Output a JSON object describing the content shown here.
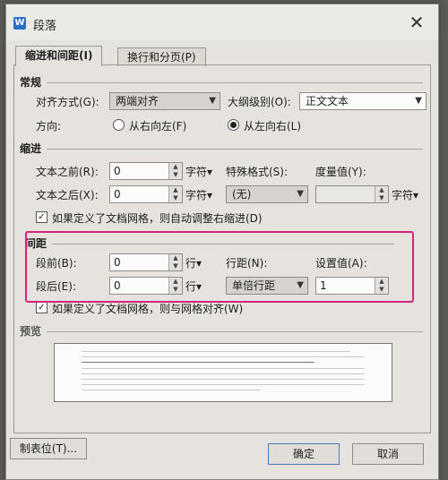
{
  "window": {
    "title": "段落",
    "app_icon": "W"
  },
  "tabs": [
    {
      "label": "缩进和间距(I)",
      "active": true
    },
    {
      "label": "换行和分页(P)",
      "active": false
    }
  ],
  "general": {
    "heading": "常规",
    "alignment_label": "对齐方式(G):",
    "alignment_value": "两端对齐",
    "outline_label": "大纲级别(O):",
    "outline_value": "正文文本",
    "direction_label": "方向:",
    "rtl_label": "从右向左(F)",
    "ltr_label": "从左向右(L)"
  },
  "indent": {
    "heading": "缩进",
    "before_label": "文本之前(R):",
    "before_value": "0",
    "after_label": "文本之后(X):",
    "after_value": "0",
    "unit": "字符▾",
    "special_label": "特殊格式(S):",
    "special_value": "(无)",
    "measure_label": "度量值(Y):",
    "measure_value": "",
    "auto_adjust_label": "如果定义了文档网格，则自动调整右缩进(D)"
  },
  "spacing": {
    "heading": "间距",
    "before_label": "段前(B):",
    "before_value": "0",
    "after_label": "段后(E):",
    "after_value": "0",
    "unit": "行▾",
    "line_label": "行距(N):",
    "line_value": "单倍行距",
    "set_label": "设置值(A):",
    "set_value": "1",
    "snap_label": "如果定义了文档网格，则与网格对齐(W)"
  },
  "preview": {
    "heading": "预览"
  },
  "buttons": {
    "tabs": "制表位(T)...",
    "ok": "确定",
    "cancel": "取消"
  },
  "colors": {
    "highlight": "#d4267c",
    "default_button_border": "#4a78c2"
  }
}
